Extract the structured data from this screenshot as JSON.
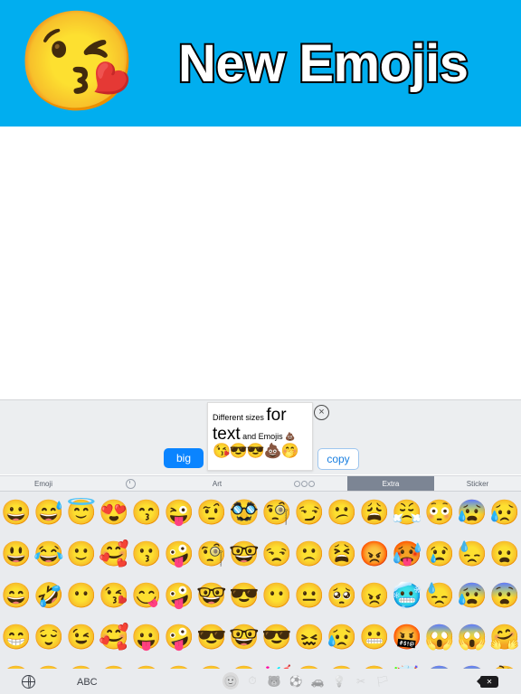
{
  "banner": {
    "title": "New Emojis",
    "emoji": "😘",
    "background_color": "#01aeef",
    "title_color": "#ffffff",
    "title_outline_color": "#000000"
  },
  "accessory": {
    "big_label": "big",
    "copy_label": "copy",
    "close_label": "×",
    "popup": {
      "line1_small": "Different sizes ",
      "line1_big": "for",
      "line2_big": "text",
      "line2_small": " and Emojis 💩",
      "emoji_row": "😘😎😎💩🤭"
    }
  },
  "tabbar": {
    "tabs": [
      {
        "label": "Emoji",
        "icon": "",
        "selected": false
      },
      {
        "label": "",
        "icon": "clock-icon",
        "selected": false
      },
      {
        "label": "Art",
        "icon": "",
        "selected": false
      },
      {
        "label": "",
        "icon": "three-dots-icon",
        "selected": false
      },
      {
        "label": "Extra",
        "icon": "",
        "selected": true
      },
      {
        "label": "Sticker",
        "icon": "",
        "selected": false
      }
    ],
    "selected_background": "#7c8594",
    "background": "#eef0f2"
  },
  "keyboard": {
    "background": "#e9ebee",
    "rows": [
      [
        "😀",
        "😅",
        "😇",
        "😍",
        "😙",
        "😜",
        "🤨",
        "🥸",
        "🧐",
        "😏",
        "😕",
        "😩",
        "😤",
        "😳",
        "😰",
        "😥"
      ],
      [
        "😃",
        "😂",
        "🙂",
        "🥰",
        "😗",
        "🤪",
        "🧐",
        "🤓",
        "😒",
        "🙁",
        "😫",
        "😡",
        "🥵",
        "😢",
        "😓",
        "😦"
      ],
      [
        "😄",
        "🤣",
        "😶",
        "😘",
        "😋",
        "🤪",
        "🤓",
        "😎",
        "😶",
        "😐",
        "🥺",
        "😠",
        "🥶",
        "😓",
        "😰",
        "😨"
      ],
      [
        "😁",
        "😌",
        "😉",
        "🥰",
        "😛",
        "🤪",
        "😎",
        "🤓",
        "😎",
        "😖",
        "😥",
        "😬",
        "🤬",
        "😱",
        "😱",
        "🤗"
      ],
      [
        "😆",
        "😊",
        "😌",
        "😙",
        "😝",
        "🤪",
        "😎",
        "😎",
        "🥳",
        "😟",
        "😖",
        "😭",
        "🤯",
        "😨",
        "😨",
        "🤔"
      ]
    ]
  },
  "bottombar": {
    "globe_icon": "globe-icon",
    "abc_label": "ABC",
    "categories": [
      {
        "name": "smileys",
        "glyph": "🙂",
        "selected": true
      },
      {
        "name": "recent",
        "glyph": "⏱",
        "selected": false
      },
      {
        "name": "animals",
        "glyph": "🐻",
        "selected": false
      },
      {
        "name": "food",
        "glyph": "⚽",
        "selected": false
      },
      {
        "name": "travel",
        "glyph": "🚗",
        "selected": false
      },
      {
        "name": "objects",
        "glyph": "💡",
        "selected": false
      },
      {
        "name": "symbols",
        "glyph": "✂",
        "selected": false
      },
      {
        "name": "flags",
        "glyph": "🏳",
        "selected": false
      }
    ],
    "backspace_label": "✕"
  }
}
